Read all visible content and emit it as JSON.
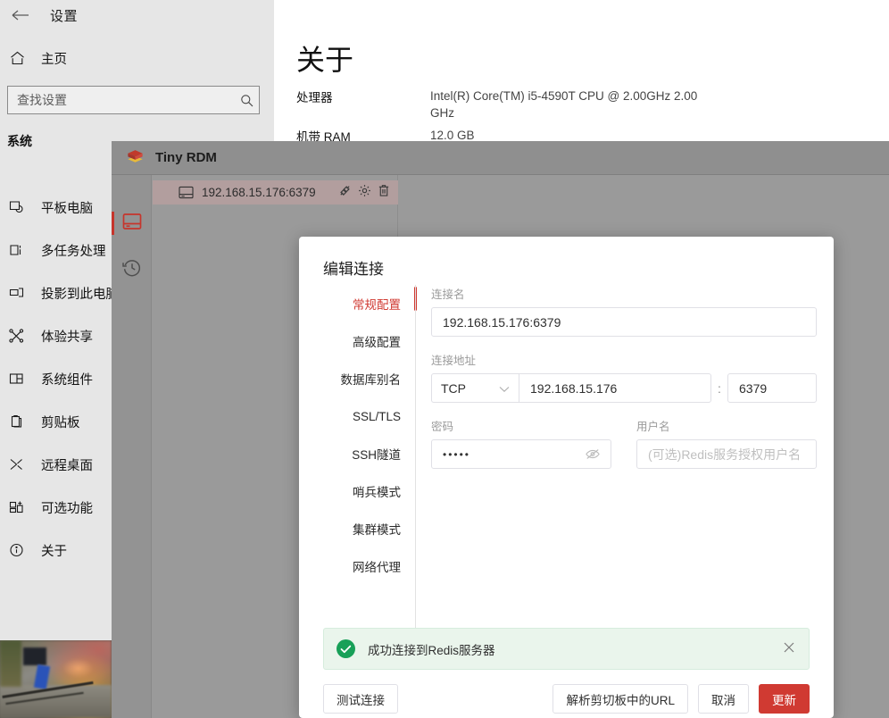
{
  "settings": {
    "back_icon": "back-arrow-icon",
    "title": "设置",
    "home": {
      "icon": "home-icon",
      "label": "主页"
    },
    "search": {
      "placeholder": "查找设置",
      "icon": "search-icon"
    },
    "group_title": "系统",
    "nav_items": [
      {
        "icon": "tablet-icon",
        "label": "平板电脑"
      },
      {
        "icon": "multitask-icon",
        "label": "多任务处理"
      },
      {
        "icon": "project-icon",
        "label": "投影到此电脑"
      },
      {
        "icon": "share-icon",
        "label": "体验共享"
      },
      {
        "icon": "components-icon",
        "label": "系统组件"
      },
      {
        "icon": "clipboard-icon",
        "label": "剪贴板"
      },
      {
        "icon": "remote-desktop-icon",
        "label": "远程桌面"
      },
      {
        "icon": "optional-features-icon",
        "label": "可选功能"
      },
      {
        "icon": "info-icon",
        "label": "关于"
      }
    ],
    "content": {
      "page_title": "关于",
      "specs": [
        {
          "label": "处理器",
          "value": "Intel(R) Core(TM) i5-4590T CPU @ 2.00GHz   2.00 GHz"
        },
        {
          "label": "机带 RAM",
          "value": "12.0 GB"
        }
      ]
    }
  },
  "rdm": {
    "app_title": "Tiny RDM",
    "logo_icon": "tiny-rdm-logo-icon",
    "rail": [
      {
        "icon": "server-icon",
        "active": true
      },
      {
        "icon": "history-icon",
        "active": false
      }
    ],
    "tree": {
      "connection_icon": "server-icon",
      "connection_name": "192.168.15.176:6379",
      "actions": [
        {
          "icon": "disconnect-icon"
        },
        {
          "icon": "gear-icon"
        },
        {
          "icon": "trash-icon"
        }
      ]
    }
  },
  "dialog": {
    "title": "编辑连接",
    "tabs": [
      {
        "label": "常规配置",
        "active": true
      },
      {
        "label": "高级配置",
        "active": false
      },
      {
        "label": "数据库别名",
        "active": false
      },
      {
        "label": "SSL/TLS",
        "active": false
      },
      {
        "label": "SSH隧道",
        "active": false
      },
      {
        "label": "哨兵模式",
        "active": false
      },
      {
        "label": "集群模式",
        "active": false
      },
      {
        "label": "网络代理",
        "active": false
      }
    ],
    "form": {
      "name_label": "连接名",
      "name_value": "192.168.15.176:6379",
      "address_label": "连接地址",
      "protocol_value": "TCP",
      "protocol_caret_icon": "chevron-down-icon",
      "host_value": "192.168.15.176",
      "colon": ":",
      "port_value": "6379",
      "password_label": "密码",
      "password_value": "•••••",
      "password_eye_icon": "eye-off-icon",
      "username_label": "用户名",
      "username_placeholder": "(可选)Redis服务授权用户名"
    },
    "alert": {
      "icon": "check-circle-icon",
      "message": "成功连接到Redis服务器",
      "close_icon": "close-icon",
      "bg_color": "#eaf5ec",
      "accent_color": "#18a058"
    },
    "buttons": {
      "test": "测试连接",
      "parse_clipboard": "解析剪切板中的URL",
      "cancel": "取消",
      "update": "更新",
      "update_color": "#d03a32"
    }
  }
}
